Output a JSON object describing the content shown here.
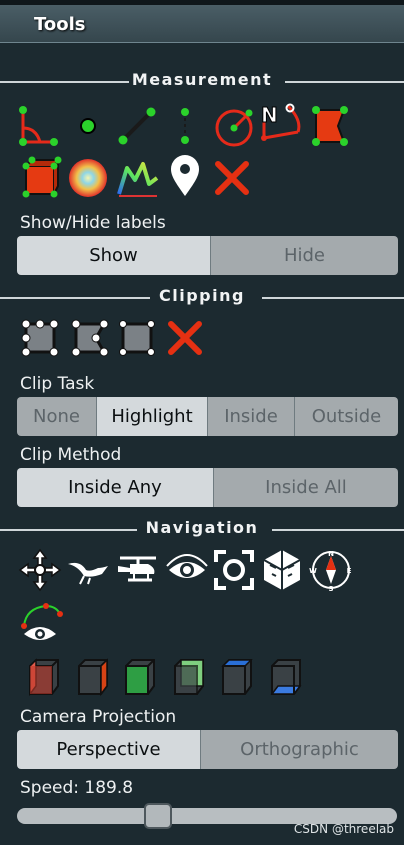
{
  "header": {
    "title": "Tools"
  },
  "measurement": {
    "section_label": "Measurement",
    "tools": [
      {
        "icon": "angle-icon"
      },
      {
        "icon": "point-icon"
      },
      {
        "icon": "distance-icon"
      },
      {
        "icon": "height-icon"
      },
      {
        "icon": "circle-icon"
      },
      {
        "icon": "azimuth-icon"
      },
      {
        "icon": "area-icon"
      },
      {
        "icon": "volume-icon"
      },
      {
        "icon": "sphere-volume-icon"
      },
      {
        "icon": "profile-icon"
      },
      {
        "icon": "annotation-icon"
      },
      {
        "icon": "remove-icon"
      }
    ],
    "labels_title": "Show/Hide labels",
    "labels_options": [
      "Show",
      "Hide"
    ],
    "labels_selected": "Show"
  },
  "clipping": {
    "section_label": "Clipping",
    "tools": [
      {
        "icon": "clip-volume-icon"
      },
      {
        "icon": "clip-polygon-icon"
      },
      {
        "icon": "clip-screen-box-icon"
      },
      {
        "icon": "remove-icon"
      }
    ],
    "task_title": "Clip Task",
    "task_options": [
      "None",
      "Highlight",
      "Inside",
      "Outside"
    ],
    "task_selected": "Highlight",
    "method_title": "Clip Method",
    "method_options": [
      "Inside Any",
      "Inside All"
    ],
    "method_selected": "Inside Any"
  },
  "navigation": {
    "section_label": "Navigation",
    "tools": [
      {
        "icon": "earth-control-icon"
      },
      {
        "icon": "fly-control-icon"
      },
      {
        "icon": "helicopter-control-icon"
      },
      {
        "icon": "orbit-control-icon"
      },
      {
        "icon": "focus-icon"
      },
      {
        "icon": "navigation-cube-icon"
      },
      {
        "icon": "compass-icon"
      },
      {
        "icon": "camera-animation-icon"
      }
    ],
    "compass_letters": {
      "n": "N",
      "s": "S",
      "e": "E",
      "w": "W"
    },
    "views": [
      {
        "icon": "left-view-icon",
        "color": "#c0392b"
      },
      {
        "icon": "right-view-icon",
        "color": "#d84315"
      },
      {
        "icon": "front-view-icon",
        "color": "#2e9e44"
      },
      {
        "icon": "back-view-icon",
        "color": "#5aa35a"
      },
      {
        "icon": "top-view-icon",
        "color": "#2a6fd6"
      },
      {
        "icon": "bottom-view-icon",
        "color": "#3b7be0"
      }
    ],
    "projection_title": "Camera Projection",
    "projection_options": [
      "Perspective",
      "Orthographic"
    ],
    "projection_selected": "Perspective",
    "speed_label": "Speed: 189.8",
    "speed_fraction": 0.36
  },
  "azimuth_letter": "N",
  "watermark": "CSDN @threelab"
}
